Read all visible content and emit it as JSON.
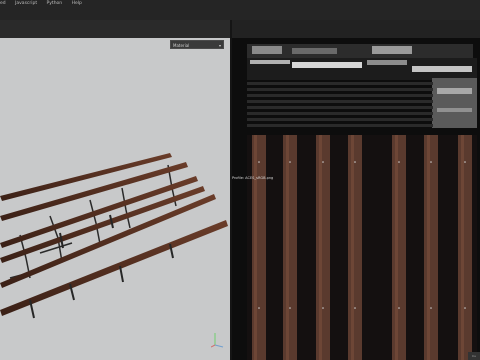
{
  "menubar": {
    "items": [
      {
        "label": "ed"
      },
      {
        "label": "Javascript"
      },
      {
        "label": "Python"
      },
      {
        "label": "Help"
      }
    ]
  },
  "toolbar": {
    "value_left": "100",
    "stroke_opacity_label": "Stroke opacity",
    "stroke_opacity_value": "100",
    "spacing_label": "Spacing",
    "spacing_value": "10",
    "right_icon_label": "AI"
  },
  "viewport3d": {
    "material_dropdown": "Material"
  },
  "viewport2d": {
    "texture_label": "Profile: ACES_sRGB.png"
  },
  "status": {
    "tag": "Cu"
  }
}
